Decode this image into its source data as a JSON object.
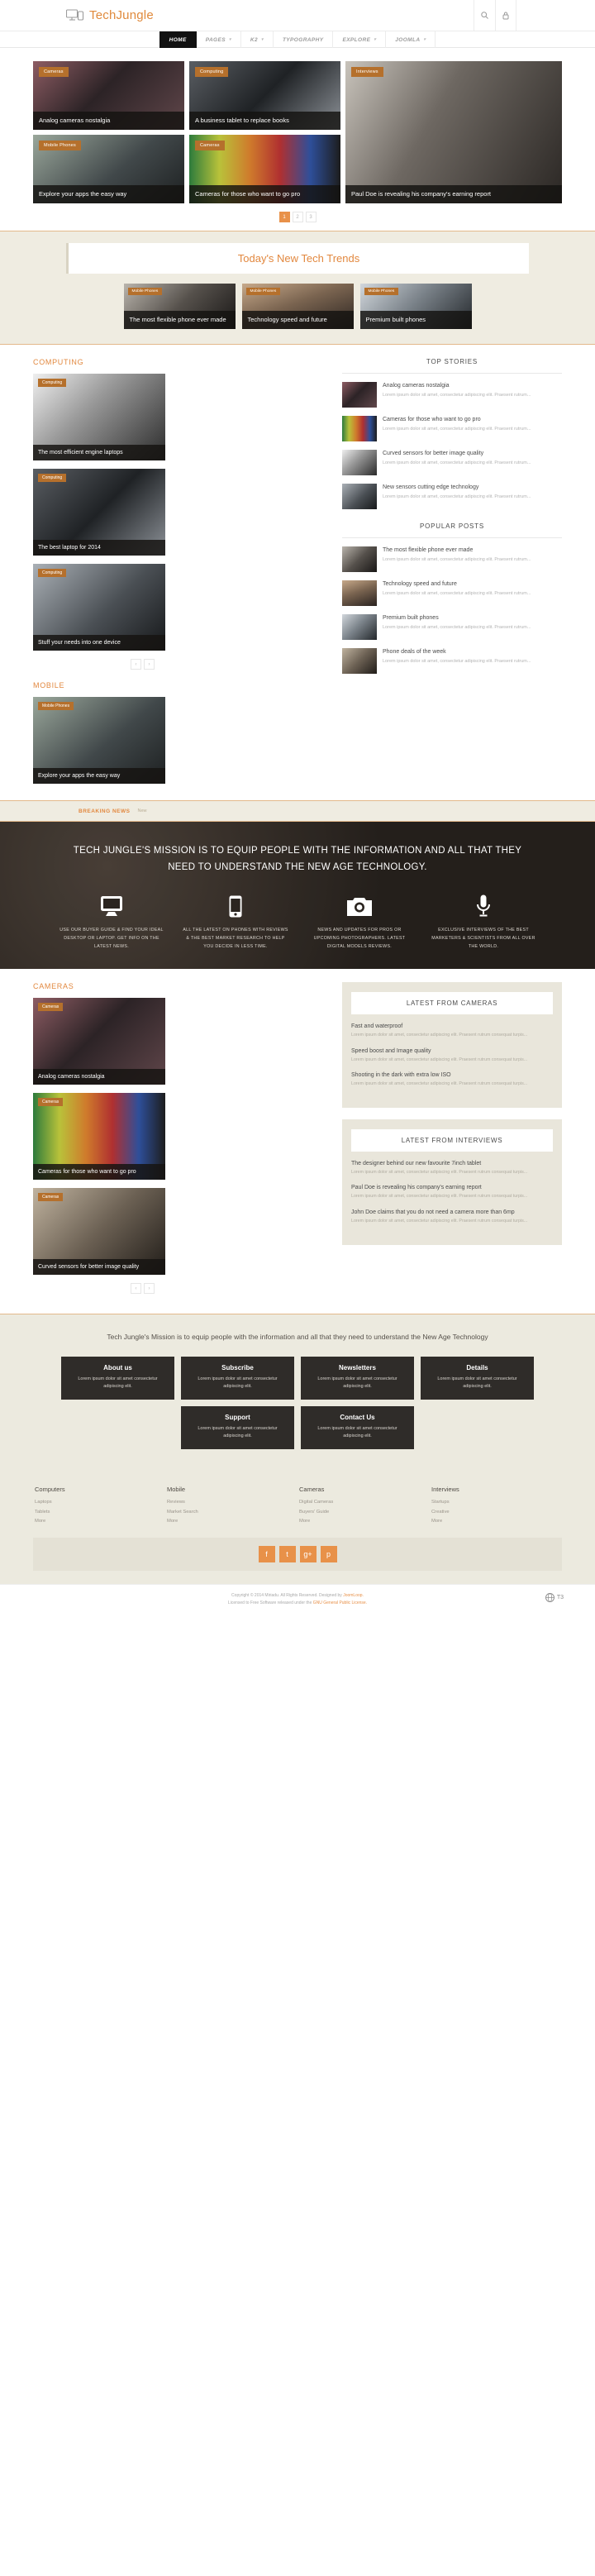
{
  "header": {
    "brand": "TechJungle",
    "icons": [
      {
        "name": "search-icon",
        "glyph": "⌕"
      },
      {
        "name": "lock-icon",
        "glyph": "⚿"
      }
    ]
  },
  "nav": {
    "items": [
      {
        "label": "HOME",
        "active": true,
        "caret": false
      },
      {
        "label": "PAGES",
        "active": false,
        "caret": true
      },
      {
        "label": "K2",
        "active": false,
        "caret": true
      },
      {
        "label": "TYPOGRAPHY",
        "active": false,
        "caret": false
      },
      {
        "label": "EXPLORE",
        "active": false,
        "caret": true
      },
      {
        "label": "JOOMLA",
        "active": false,
        "caret": true
      }
    ]
  },
  "hero": {
    "cards": [
      {
        "tag": "Cameras",
        "title": "Analog cameras nostalgia"
      },
      {
        "tag": "Computing",
        "title": "A business tablet to replace books"
      },
      {
        "tag": "Mobile Phones",
        "title": "Explore your apps the easy way"
      },
      {
        "tag": "Cameras",
        "title": "Cameras for those who want to go pro"
      },
      {
        "tag": "Interviews",
        "title": "Paul Doe is revealing his company's earning report"
      }
    ],
    "pager": [
      "1",
      "2",
      "3"
    ],
    "pager_active": "1"
  },
  "trends": {
    "title": "Today's New Tech Trends",
    "cards": [
      {
        "tag": "Mobile Phones",
        "title": "The most flexible phone ever made"
      },
      {
        "tag": "Mobile Phones",
        "title": "Technology speed and future"
      },
      {
        "tag": "Mobile Phones",
        "title": "Premium built phones"
      }
    ]
  },
  "computing": {
    "section_title": "COMPUTING",
    "posts": [
      {
        "tag": "Computing",
        "title": "The most efficient engine laptops"
      },
      {
        "tag": "Computing",
        "title": "The best laptop for 2014"
      },
      {
        "tag": "Computing",
        "title": "Stuff your needs into one device"
      }
    ],
    "prev": "‹",
    "next": "›"
  },
  "mobile": {
    "section_title": "MOBILE",
    "posts": [
      {
        "tag": "Mobile Phones",
        "title": "Explore your apps the easy way"
      }
    ]
  },
  "sidebar": {
    "top_stories": {
      "title": "TOP STORIES",
      "items": [
        {
          "title": "Analog cameras nostalgia",
          "excerpt": "Lorem ipsum dolor sit amet, consectetur adipiscing elit. Praesent rutrum..."
        },
        {
          "title": "Cameras for those who want to go pro",
          "excerpt": "Lorem ipsum dolor sit amet, consectetur adipiscing elit. Praesent rutrum..."
        },
        {
          "title": "Curved sensors for better image quality",
          "excerpt": "Lorem ipsum dolor sit amet, consectetur adipiscing elit. Praesent rutrum..."
        },
        {
          "title": "New sensors cutting edge technology",
          "excerpt": "Lorem ipsum dolor sit amet, consectetur adipiscing elit. Praesent rutrum..."
        }
      ]
    },
    "popular_posts": {
      "title": "POPULAR POSTS",
      "items": [
        {
          "title": "The most flexible phone ever made",
          "excerpt": "Lorem ipsum dolor sit amet, consectetur adipiscing elit. Praesent rutrum..."
        },
        {
          "title": "Technology speed and future",
          "excerpt": "Lorem ipsum dolor sit amet, consectetur adipiscing elit. Praesent rutrum..."
        },
        {
          "title": "Premium built phones",
          "excerpt": "Lorem ipsum dolor sit amet, consectetur adipiscing elit. Praesent rutrum..."
        },
        {
          "title": "Phone deals of the week",
          "excerpt": "Lorem ipsum dolor sit amet, consectetur adipiscing elit. Praesent rutrum..."
        }
      ]
    }
  },
  "breaking": {
    "label": "BREAKING NEWS",
    "item": "New"
  },
  "mission": {
    "headline": "TECH JUNGLE'S MISSION IS TO EQUIP PEOPLE WITH THE INFORMATION AND ALL THAT THEY NEED TO UNDERSTAND THE NEW AGE TECHNOLOGY.",
    "features": [
      {
        "icon": "desktop-icon",
        "text": "USE OUR BUYER GUIDE & FIND YOUR IDEAL DESKTOP OR LAPTOP. GET INFO ON THE LATEST NEWS."
      },
      {
        "icon": "mobile-phone-icon",
        "text": "ALL THE LATEST ON PHONES WITH REVIEWS & THE BEST MARKET RESEARCH TO HELP YOU DECIDE IN LESS TIME."
      },
      {
        "icon": "camera-icon",
        "text": "NEWS AND UPDATES FOR PROS OR UPCOMING PHOTOGRAPHERS. LATEST DIGITAL MODELS REVIEWS."
      },
      {
        "icon": "microphone-icon",
        "text": "EXCLUSIVE INTERVIEWS OF THE BEST MARKETERS & SCIENTISTS FROM ALL OVER THE WORLD."
      }
    ]
  },
  "cameras": {
    "section_title": "CAMERAS",
    "posts": [
      {
        "tag": "Cameras",
        "title": "Analog cameras nostalgia"
      },
      {
        "tag": "Cameras",
        "title": "Cameras for those who want to go pro"
      },
      {
        "tag": "Cameras",
        "title": "Curved sensors for better image quality"
      }
    ],
    "prev": "‹",
    "next": "›"
  },
  "cam_sidebar": {
    "latest_cameras": {
      "title": "LATEST FROM CAMERAS",
      "items": [
        {
          "title": "Fast and waterproof",
          "excerpt": "Lorem ipsum dolor sit amet, consectetur adipiscing elit. Praesent rutrum consequat turpis..."
        },
        {
          "title": "Speed boost and Image quality",
          "excerpt": "Lorem ipsum dolor sit amet, consectetur adipiscing elit. Praesent rutrum consequat turpis..."
        },
        {
          "title": "Shooting in the dark with extra low ISO",
          "excerpt": "Lorem ipsum dolor sit amet, consectetur adipiscing elit. Praesent rutrum consequat turpis..."
        }
      ]
    },
    "latest_interviews": {
      "title": "LATEST FROM INTERVIEWS",
      "items": [
        {
          "title": "The designer behind our new favourite 7inch tablet",
          "excerpt": "Lorem ipsum dolor sit amet, consectetur adipiscing elit. Praesent rutrum consequat turpis..."
        },
        {
          "title": "Paul Doe is revealing his company's earning report",
          "excerpt": "Lorem ipsum dolor sit amet, consectetur adipiscing elit. Praesent rutrum consequat turpis..."
        },
        {
          "title": "John Doe claims that you do not need a camera more than 6mp",
          "excerpt": "Lorem ipsum dolor sit amet, consectetur adipiscing elit. Praesent rutrum consequat turpis..."
        }
      ]
    }
  },
  "footer": {
    "mission": "Tech Jungle's Mission is to equip people with the information and all that they need to understand the New Age Technology",
    "boxes": [
      {
        "title": "About us",
        "text": "Lorem ipsum dolor sit amet consectetur adipiscing elit."
      },
      {
        "title": "Subscribe",
        "text": "Lorem ipsum dolor sit amet consectetur adipiscing elit."
      },
      {
        "title": "Newsletters",
        "text": "Lorem ipsum dolor sit amet consectetur adipiscing elit."
      },
      {
        "title": "Details",
        "text": "Lorem ipsum dolor sit amet consectetur adipiscing elit."
      },
      {
        "title": "Support",
        "text": "Lorem ipsum dolor sit amet consectetur adipiscing elit."
      },
      {
        "title": "Contact Us",
        "text": "Lorem ipsum dolor sit amet consectetur adipiscing elit."
      }
    ],
    "link_columns": [
      {
        "heading": "Computers",
        "links": [
          "Laptops",
          "Tablets",
          "More"
        ]
      },
      {
        "heading": "Mobile",
        "links": [
          "Reviews",
          "Market Search",
          "More"
        ]
      },
      {
        "heading": "Cameras",
        "links": [
          "Digital Cameras",
          "Buyers' Guide",
          "More"
        ]
      },
      {
        "heading": "Interviews",
        "links": [
          "Startups",
          "Creative",
          "More"
        ]
      }
    ],
    "social": [
      {
        "name": "facebook-icon",
        "glyph": "f"
      },
      {
        "name": "twitter-icon",
        "glyph": "t"
      },
      {
        "name": "google-plus-icon",
        "glyph": "g+"
      },
      {
        "name": "pinterest-icon",
        "glyph": "p"
      }
    ],
    "copyright_line1": "Copyright © 2014 Miriadu. All Rights Reserved. Designed by",
    "copyright_link1": "JoomLoop.",
    "copyright_line2": "Licensed to Free Software released under the",
    "copyright_link2": "GNU General Public License.",
    "badge": "T3"
  }
}
